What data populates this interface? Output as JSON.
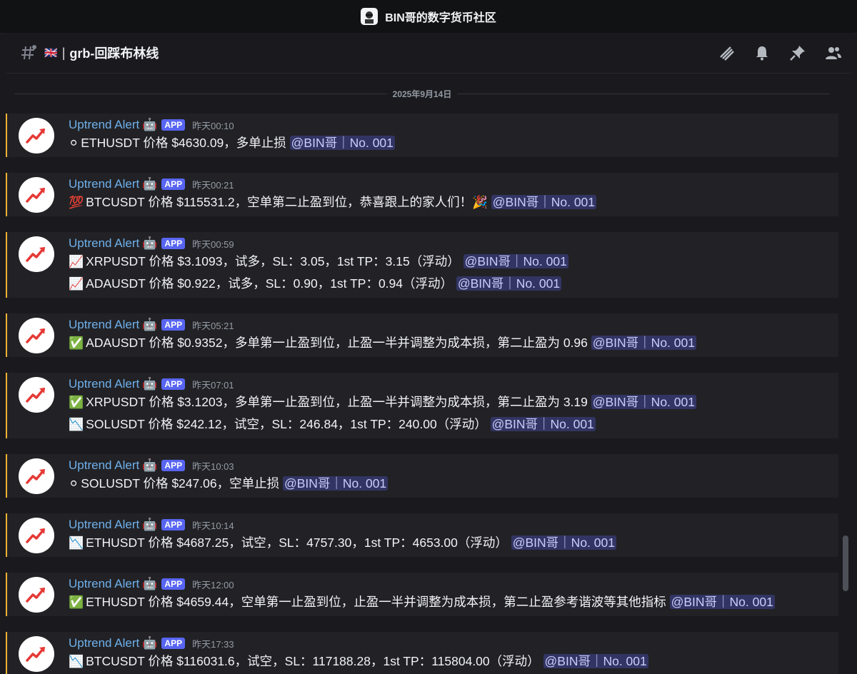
{
  "window": {
    "title": "BIN哥的数字货币社区"
  },
  "channel": {
    "flag": "🇬🇧",
    "separator": "|",
    "name": "grb-回踩布林线"
  },
  "header_icons": [
    "threads-icon",
    "bell-icon",
    "pin-icon",
    "members-icon"
  ],
  "date_divider": "2025年9月14日",
  "messages": [
    {
      "author": "Uptrend Alert",
      "badge": "APP",
      "time": "昨天00:10",
      "lines": [
        {
          "emoji": "⚪",
          "text": "ETHUSDT 价格 $4630.09，多单止损 ",
          "mention": "@BIN哥｜No. 001"
        }
      ]
    },
    {
      "author": "Uptrend Alert",
      "badge": "APP",
      "time": "昨天00:21",
      "lines": [
        {
          "emoji": "💯",
          "text": "BTCUSDT 价格 $115531.2，空单第二止盈到位，恭喜跟上的家人们！🎉 ",
          "mention": "@BIN哥｜No. 001"
        }
      ]
    },
    {
      "author": "Uptrend Alert",
      "badge": "APP",
      "time": "昨天00:59",
      "lines": [
        {
          "emoji": "📈",
          "text": "XRPUSDT 价格 $3.1093，试多，SL：3.05，1st TP：3.15（浮动） ",
          "mention": "@BIN哥｜No. 001"
        },
        {
          "emoji": "📈",
          "text": "ADAUSDT 价格 $0.922，试多，SL：0.90，1st TP：0.94（浮动） ",
          "mention": "@BIN哥｜No. 001"
        }
      ]
    },
    {
      "author": "Uptrend Alert",
      "badge": "APP",
      "time": "昨天05:21",
      "lines": [
        {
          "emoji": "✅",
          "text": "ADAUSDT 价格 $0.9352，多单第一止盈到位，止盈一半并调整为成本损，第二止盈为 0.96 ",
          "mention": "@BIN哥｜No. 001"
        }
      ]
    },
    {
      "author": "Uptrend Alert",
      "badge": "APP",
      "time": "昨天07:01",
      "lines": [
        {
          "emoji": "✅",
          "text": "XRPUSDT 价格 $3.1203，多单第一止盈到位，止盈一半并调整为成本损，第二止盈为 3.19 ",
          "mention": "@BIN哥｜No. 001"
        },
        {
          "emoji": "📉",
          "text": "SOLUSDT 价格 $242.12，试空，SL：246.84，1st TP：240.00（浮动） ",
          "mention": "@BIN哥｜No. 001"
        }
      ]
    },
    {
      "author": "Uptrend Alert",
      "badge": "APP",
      "time": "昨天10:03",
      "lines": [
        {
          "emoji": "⚪",
          "text": "SOLUSDT 价格 $247.06，空单止损 ",
          "mention": "@BIN哥｜No. 001"
        }
      ]
    },
    {
      "author": "Uptrend Alert",
      "badge": "APP",
      "time": "昨天10:14",
      "lines": [
        {
          "emoji": "📉",
          "text": "ETHUSDT 价格 $4687.25，试空，SL：4757.30，1st TP：4653.00（浮动） ",
          "mention": "@BIN哥｜No. 001"
        }
      ]
    },
    {
      "author": "Uptrend Alert",
      "badge": "APP",
      "time": "昨天12:00",
      "lines": [
        {
          "emoji": "✅",
          "text": "ETHUSDT 价格 $4659.44，空单第一止盈到位，止盈一半并调整为成本损，第二止盈参考谐波等其他指标 ",
          "mention": "@BIN哥｜No. 001"
        }
      ]
    },
    {
      "author": "Uptrend Alert",
      "badge": "APP",
      "time": "昨天17:33",
      "lines": [
        {
          "emoji": "📉",
          "text": "BTCUSDT 价格 $116031.6，试空，SL：117188.28，1st TP：115804.00（浮动） ",
          "mention": "@BIN哥｜No. 001"
        }
      ]
    }
  ],
  "colors": {
    "accent_border": "#f0b232",
    "author": "#6fb1ec",
    "badge": "#5865f2",
    "mention_bg": "#3b3f70"
  }
}
